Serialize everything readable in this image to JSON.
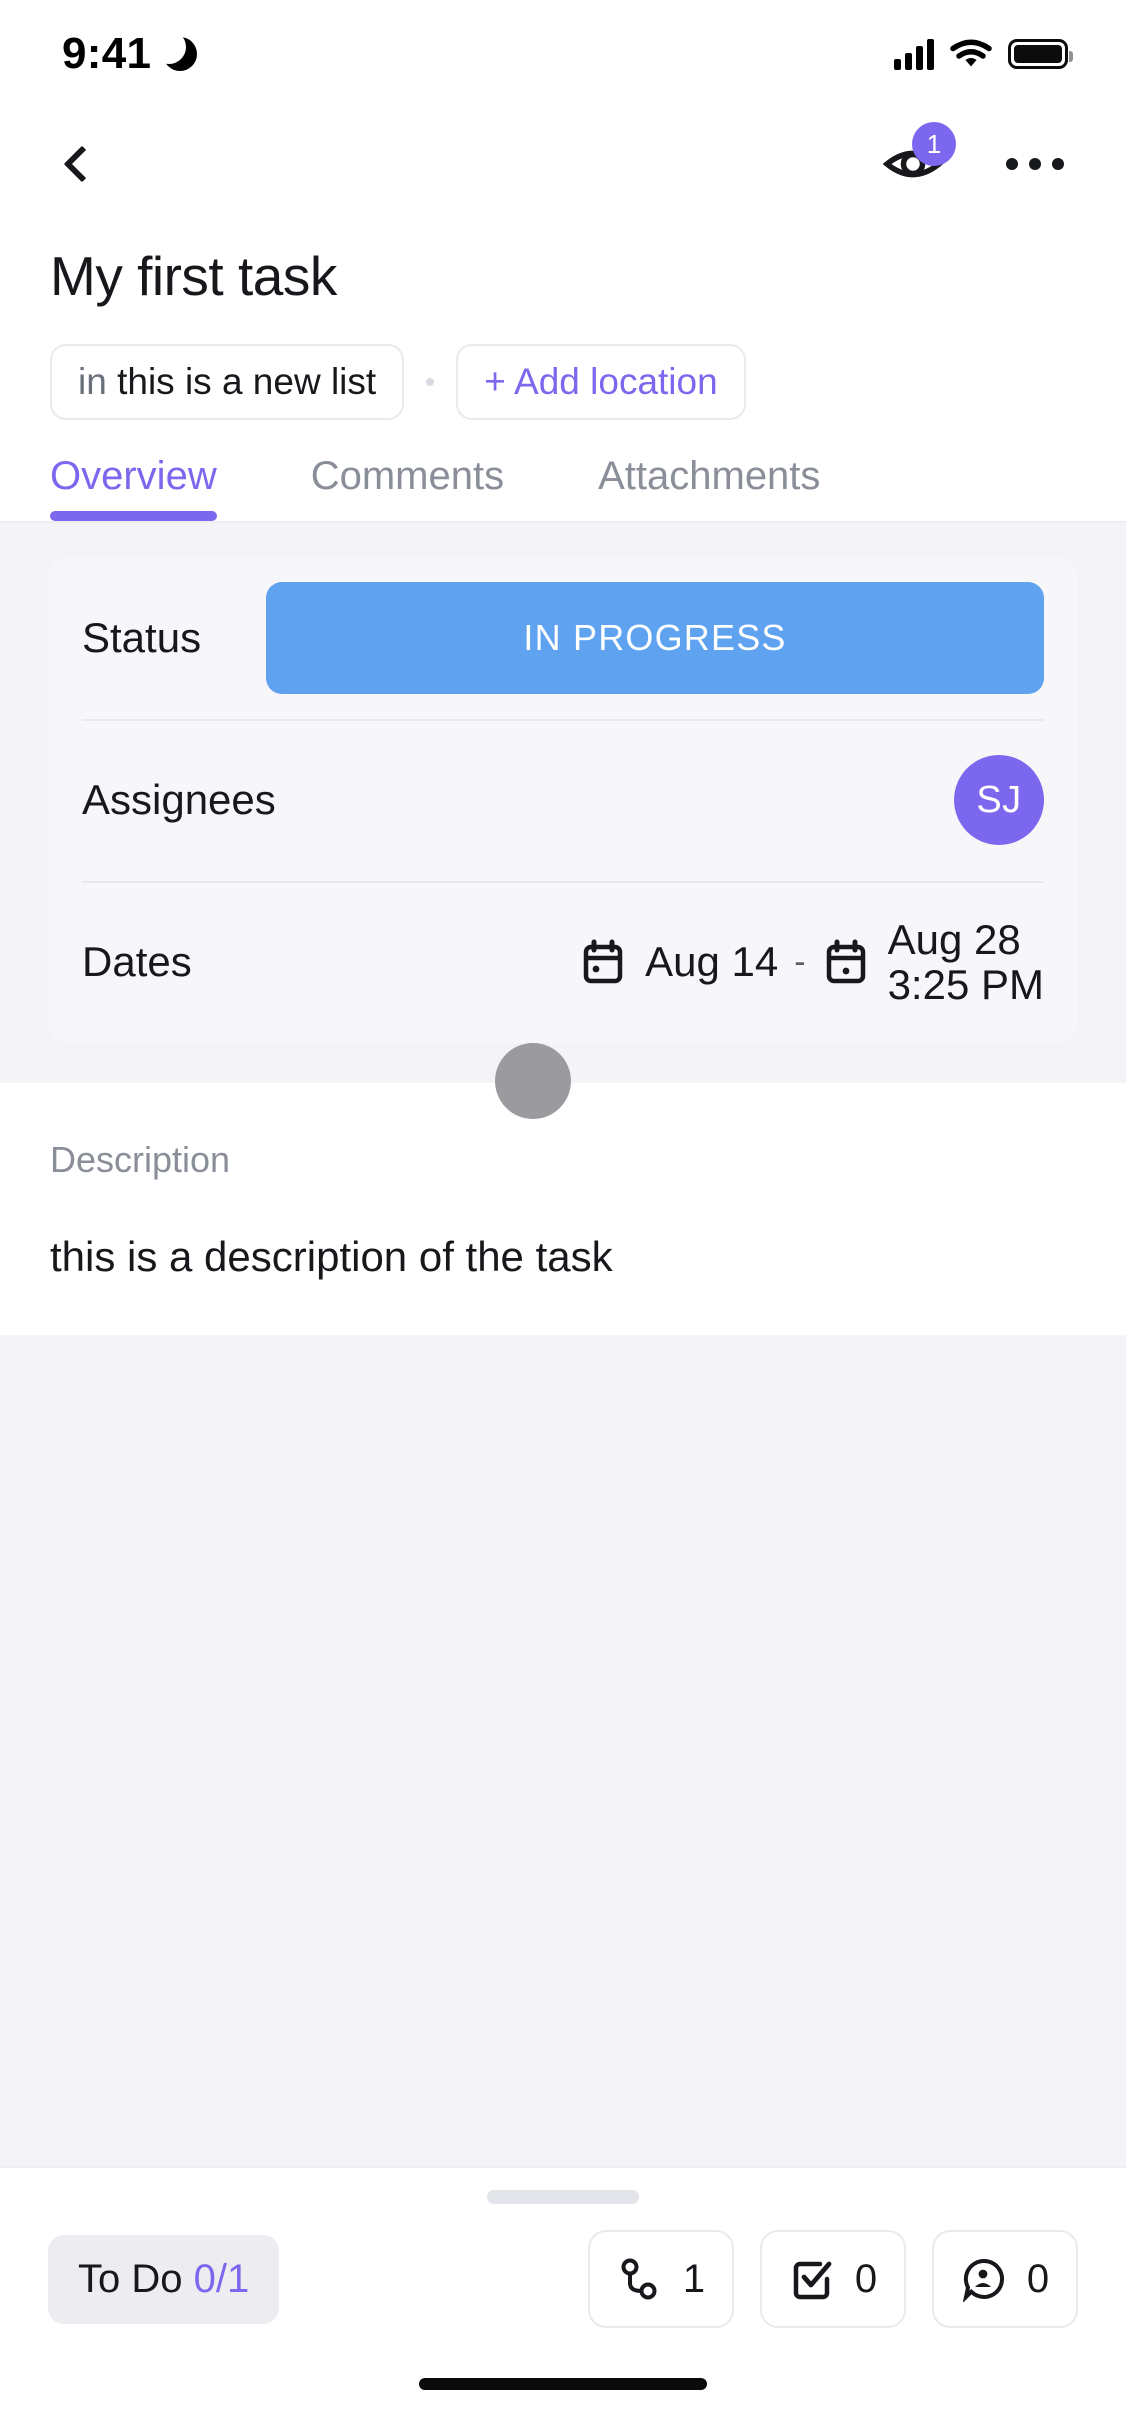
{
  "status_bar": {
    "time": "9:41",
    "dnd_icon": "crescent-moon-icon",
    "signal_icon": "cellular-signal-icon",
    "wifi_icon": "wifi-icon",
    "battery_icon": "battery-full-icon"
  },
  "navbar": {
    "back_icon": "chevron-left-icon",
    "watchers_icon": "eye-icon",
    "watchers_count": "1",
    "more_icon": "ellipsis-icon"
  },
  "header": {
    "title": "My first task",
    "location_chip_prefix": "in",
    "location_chip_name": "this is a new list",
    "add_location_label": "+ Add location"
  },
  "tabs": [
    {
      "label": "Overview",
      "active": true
    },
    {
      "label": "Comments",
      "active": false
    },
    {
      "label": "Attachments",
      "active": false
    }
  ],
  "overview": {
    "status": {
      "label": "Status",
      "value": "IN PROGRESS",
      "color": "#5FA3F0"
    },
    "assignees": {
      "label": "Assignees",
      "avatar_initials": "SJ",
      "avatar_color": "#7B68EE"
    },
    "dates": {
      "label": "Dates",
      "start_icon": "calendar-icon",
      "start": "Aug 14",
      "separator": "-",
      "end_icon": "calendar-icon",
      "end_date": "Aug 28",
      "end_time": "3:25 PM"
    }
  },
  "description": {
    "label": "Description",
    "body": "this is a description of the task"
  },
  "bottom_bar": {
    "todo_label": "To Do",
    "todo_fraction": "0/1",
    "actions": [
      {
        "icon": "subtask-link-icon",
        "count": "1"
      },
      {
        "icon": "checklist-icon",
        "count": "0"
      },
      {
        "icon": "mention-bubble-icon",
        "count": "0"
      }
    ]
  },
  "accent": {
    "purple": "#7B68EE",
    "blue": "#5FA3F0",
    "muted": "#8a8e99"
  }
}
